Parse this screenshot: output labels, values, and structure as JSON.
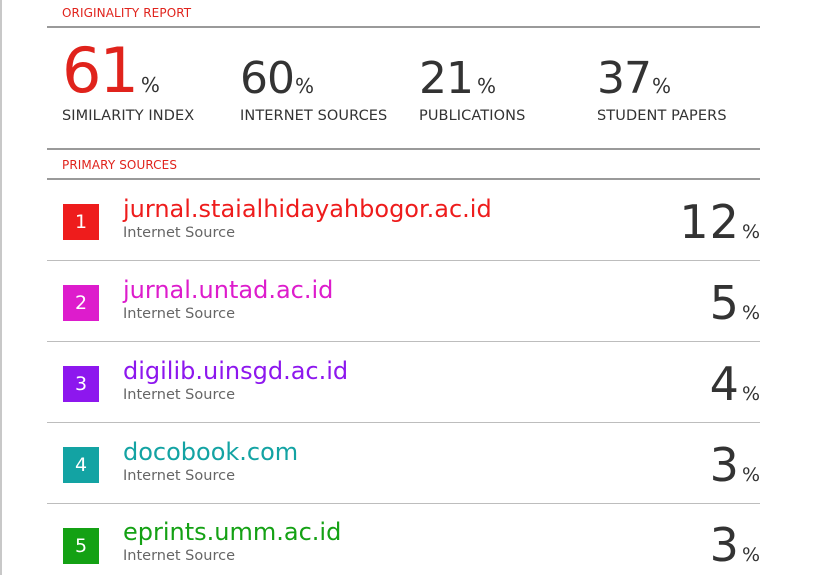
{
  "report": {
    "title": "ORIGINALITY REPORT",
    "stats": [
      {
        "value": "61",
        "unit": "%",
        "label": "SIMILARITY INDEX"
      },
      {
        "value": "60",
        "unit": "%",
        "label": "INTERNET SOURCES"
      },
      {
        "value": "21",
        "unit": "%",
        "label": "PUBLICATIONS"
      },
      {
        "value": "37",
        "unit": "%",
        "label": "STUDENT PAPERS"
      }
    ]
  },
  "primary_sources": {
    "title": "PRIMARY SOURCES",
    "items": [
      {
        "rank": "1",
        "name": "jurnal.staialhidayahbogor.ac.id",
        "type": "Internet Source",
        "percent": "12",
        "unit": "%",
        "color": "#ee1c1c"
      },
      {
        "rank": "2",
        "name": "jurnal.untad.ac.id",
        "type": "Internet Source",
        "percent": "5",
        "unit": "%",
        "color": "#dd1ccc"
      },
      {
        "rank": "3",
        "name": "digilib.uinsgd.ac.id",
        "type": "Internet Source",
        "percent": "4",
        "unit": "%",
        "color": "#8d17ee"
      },
      {
        "rank": "4",
        "name": "docobook.com",
        "type": "Internet Source",
        "percent": "3",
        "unit": "%",
        "color": "#13a3a3"
      },
      {
        "rank": "5",
        "name": "eprints.umm.ac.id",
        "type": "Internet Source",
        "percent": "3",
        "unit": "%",
        "color": "#14a114"
      }
    ]
  },
  "colors": {
    "accent": "#e0231c",
    "text": "#333333",
    "muted": "#666666"
  }
}
